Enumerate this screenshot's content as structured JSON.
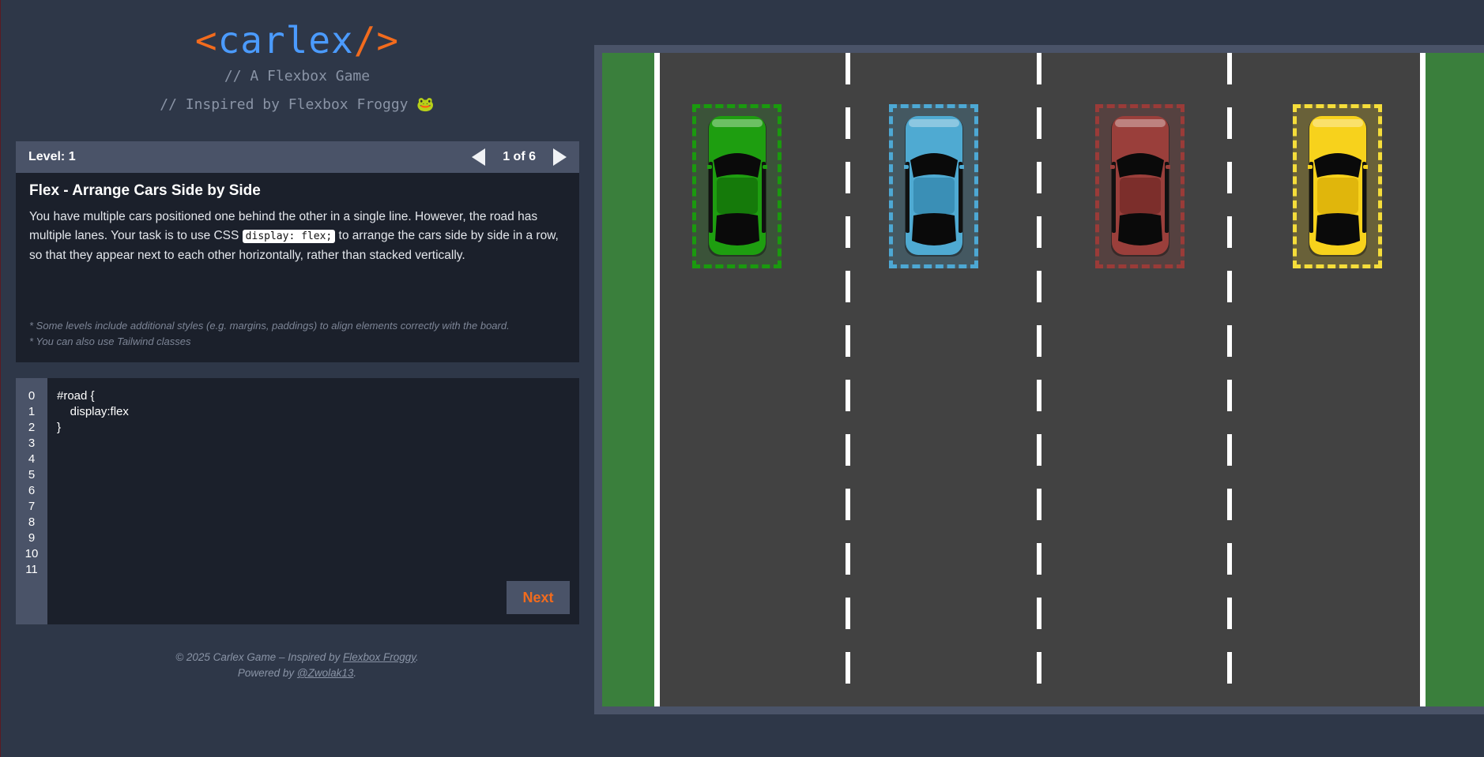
{
  "header": {
    "logo_open": "<",
    "logo_text": "carlex",
    "logo_close": "/>",
    "subtitle1": "// A Flexbox Game",
    "subtitle2": "// Inspired by Flexbox Froggy 🐸"
  },
  "level": {
    "label": "Level: 1",
    "counter": "1 of 6",
    "title": "Flex - Arrange Cars Side by Side",
    "desc_before": "You have multiple cars positioned one behind the other in a single line. However, the road has multiple lanes. Your task is to use CSS ",
    "desc_code": "display: flex;",
    "desc_after": " to arrange the cars side by side in a row, so that they appear next to each other horizontally, rather than stacked vertically.",
    "note1": "* Some levels include additional styles (e.g. margins, paddings) to align elements correctly with the board.",
    "note2": "* You can also use Tailwind classes"
  },
  "editor": {
    "line_numbers": [
      "0",
      "1",
      "2",
      "3",
      "4",
      "5",
      "6",
      "7",
      "8",
      "9",
      "10",
      "11"
    ],
    "code_lines": [
      "#road {",
      "    display:flex",
      "}"
    ],
    "next_label": "Next"
  },
  "footer": {
    "line1_prefix": "© 2025 Carlex Game – Inspired by ",
    "line1_link": "Flexbox Froggy",
    "line1_suffix": ".",
    "line2_prefix": "Powered by ",
    "line2_link": "@Zwolak13",
    "line2_suffix": "."
  },
  "board": {
    "cars": [
      {
        "name": "green-car",
        "color": "#1e9e10",
        "dark": "#157a0a",
        "border": "#1a9a0e",
        "tint": "rgba(30,158,16,0.18)"
      },
      {
        "name": "blue-car",
        "color": "#4faad2",
        "dark": "#3a8fb6",
        "border": "#4da8d4",
        "tint": "rgba(79,170,210,0.22)"
      },
      {
        "name": "red-car",
        "color": "#9a3f3b",
        "dark": "#7c2e2b",
        "border": "#9a3b38",
        "tint": "rgba(154,63,59,0.22)"
      },
      {
        "name": "yellow-car",
        "color": "#f7d21c",
        "dark": "#e0b60c",
        "border": "#f5dd3a",
        "tint": "rgba(247,210,28,0.22)"
      }
    ],
    "colors": {
      "grass": "#3a7f3c",
      "asphalt": "#424242",
      "frame": "#4a5368"
    }
  }
}
